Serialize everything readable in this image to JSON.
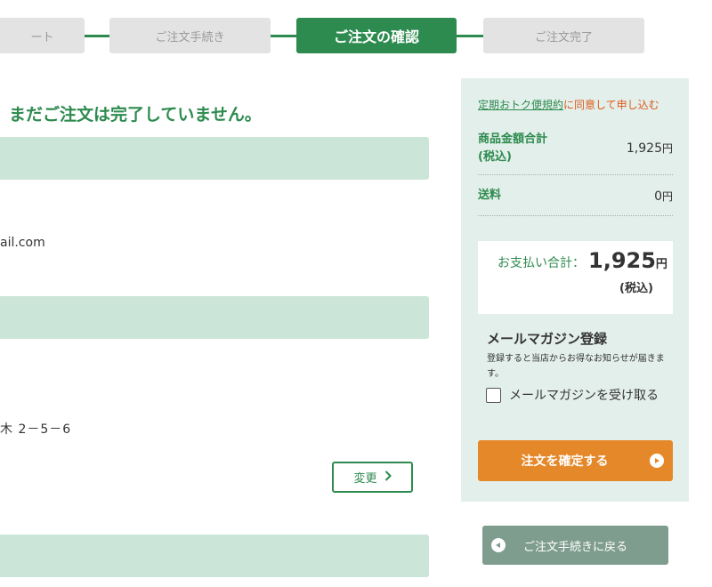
{
  "steps": [
    {
      "label": "ート",
      "active": false
    },
    {
      "label": "ご注文手続き",
      "active": false
    },
    {
      "label": "ご注文の確認",
      "active": true
    },
    {
      "label": "ご注文完了",
      "active": false
    }
  ],
  "main": {
    "notice": "まだご注文は完了していません。",
    "email_fragment": "ail.com",
    "address_fragment": "木 2－5－6",
    "change_button": "変更"
  },
  "summary": {
    "agree_link": "定期おトク便規約",
    "agree_rest": "に同意して申し込む",
    "subtotal_label": "商品金額合計\n(税込)",
    "subtotal_value": "1,925",
    "shipping_label": "送料",
    "shipping_value": "0",
    "yen": "円",
    "total_label": "お支払い合計：",
    "total_value": "1,925",
    "total_tax": "(税込)"
  },
  "mail_magazine": {
    "title": "メールマガジン登録",
    "description": "登録すると当店からお得なお知らせが届きます。",
    "checkbox_label": "メールマガジンを受け取る",
    "checked": false
  },
  "buttons": {
    "confirm": "注文を確定する",
    "back": "ご注文手続きに戻る"
  },
  "colors": {
    "brand_green": "#2e8b4f",
    "section_green": "#cce5d9",
    "panel_bg": "#e3efeb",
    "confirm_orange": "#e5882a",
    "back_gray_green": "#7f9d8f",
    "agree_red": "#e05a1c"
  },
  "icons": {
    "change_button": "chevron-right-icon",
    "confirm_button": "play-circle-icon",
    "back_button": "back-circle-icon"
  }
}
